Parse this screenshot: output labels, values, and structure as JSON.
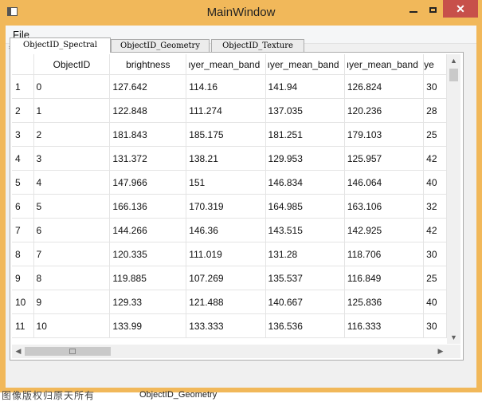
{
  "window": {
    "title": "MainWindow",
    "close_glyph": "✕",
    "minimize_icon": "minimize-icon",
    "maximize_icon": "maximize-icon"
  },
  "menubar": {
    "file_label": "File"
  },
  "tabs": [
    {
      "label": "ObjectID_Spectral",
      "active": true
    },
    {
      "label": "ObjectID_Geometry",
      "active": false
    },
    {
      "label": "ObjectID_Texture",
      "active": false
    }
  ],
  "table": {
    "columns": [
      "ObjectID",
      "brightness",
      "layer_mean_band",
      "layer_mean_band",
      "layer_mean_band",
      "ye"
    ],
    "visible_headers": [
      "ObjectID",
      "brightness",
      "ıyer_mean_band",
      "ıyer_mean_band",
      "ıyer_mean_band",
      "ye"
    ],
    "rows": [
      {
        "row": "1",
        "cells": [
          "0",
          "127.642",
          "114.16",
          "141.94",
          "126.824",
          "30"
        ]
      },
      {
        "row": "2",
        "cells": [
          "1",
          "122.848",
          "111.274",
          "137.035",
          "120.236",
          "28"
        ]
      },
      {
        "row": "3",
        "cells": [
          "2",
          "181.843",
          "185.175",
          "181.251",
          "179.103",
          "25"
        ]
      },
      {
        "row": "4",
        "cells": [
          "3",
          "131.372",
          "138.21",
          "129.953",
          "125.957",
          "42"
        ]
      },
      {
        "row": "5",
        "cells": [
          "4",
          "147.966",
          "151",
          "146.834",
          "146.064",
          "40"
        ]
      },
      {
        "row": "6",
        "cells": [
          "5",
          "166.136",
          "170.319",
          "164.985",
          "163.106",
          "32"
        ]
      },
      {
        "row": "7",
        "cells": [
          "6",
          "144.266",
          "146.36",
          "143.515",
          "142.925",
          "42"
        ]
      },
      {
        "row": "8",
        "cells": [
          "7",
          "120.335",
          "111.019",
          "131.28",
          "118.706",
          "30"
        ]
      },
      {
        "row": "9",
        "cells": [
          "8",
          "119.885",
          "107.269",
          "135.537",
          "116.849",
          "25"
        ]
      },
      {
        "row": "10",
        "cells": [
          "9",
          "129.33",
          "121.488",
          "140.667",
          "125.836",
          "40"
        ]
      },
      {
        "row": "11",
        "cells": [
          "10",
          "133.99",
          "133.333",
          "136.536",
          "116.333",
          "30"
        ]
      }
    ]
  },
  "scrollbars": {
    "up": "▲",
    "down": "▼",
    "left": "◀",
    "right": "▶"
  },
  "watermark": {
    "left_text": "图像版权归原天所有",
    "mid_text": "ObjectID_Geometry"
  },
  "colors": {
    "title_bar": "#f1b85a",
    "close_button": "#c7504a",
    "tab_active_bg": "#ffffff"
  }
}
